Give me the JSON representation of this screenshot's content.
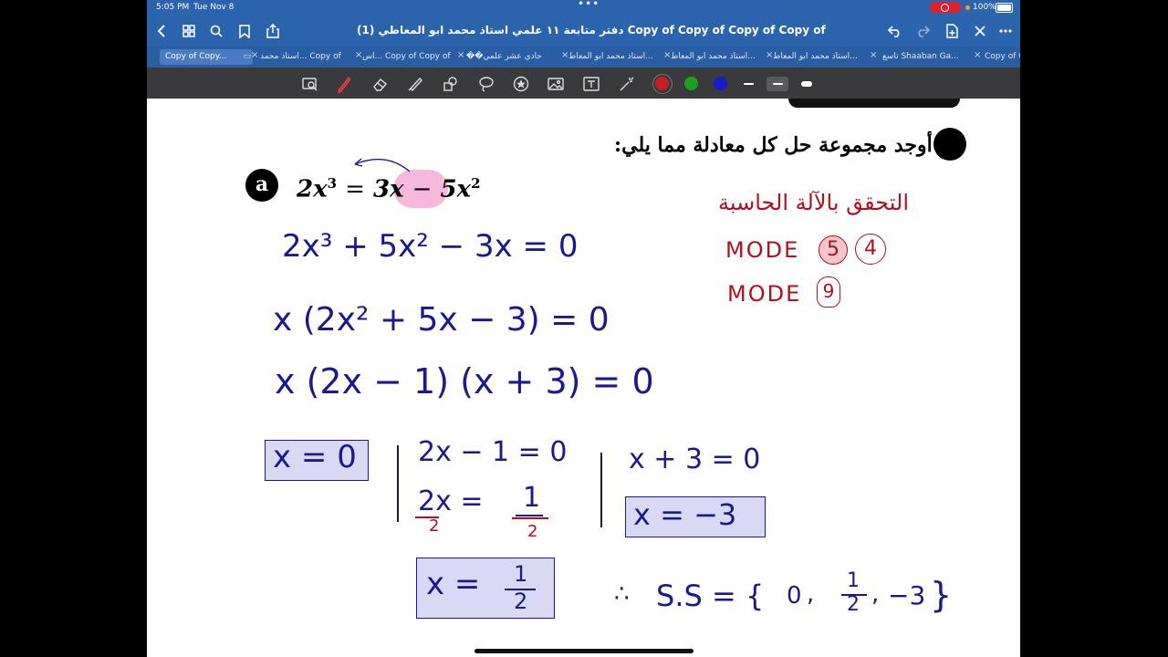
{
  "status_bar": {
    "time": "5:05 PM",
    "date": "Tue Nov 8",
    "battery": "100%"
  },
  "title_bar": {
    "title": "دفتر متابعة ١١ علمي استاذ محمد ابو المعاطي (1) Copy of Copy of Copy of Copy of"
  },
  "tabs": [
    {
      "label": "Copy of Copy..."
    },
    {
      "label": "استاذ محمد... Copy of"
    },
    {
      "label": "اس... Copy of Copy of"
    },
    {
      "label": "��حادي عشر علمي"
    },
    {
      "label": "استاذ محمد ابو المعاط..."
    },
    {
      "label": "استاذ محمد ابو المعاط..."
    },
    {
      "label": "استاذ محمد ابو المعاط..."
    },
    {
      "label": "تاسع Shaaban Ga..."
    },
    {
      "label": "Copy of C"
    }
  ],
  "toolbar": {
    "tools": [
      "lasso-icon",
      "pen-icon",
      "eraser-icon",
      "highlighter-icon",
      "shapes-icon",
      "lasso-select-icon",
      "sticker-icon",
      "image-icon",
      "text-icon",
      "laser-icon"
    ],
    "colors": [
      "#c81e1e",
      "#1e9e1e",
      "#1a1acc"
    ]
  },
  "page": {
    "instruction": "أوجد مجموعة حل كل معادلة مما يلي:",
    "label": "a",
    "equation": {
      "lhs": "2x",
      "lhs_exp": "3",
      "eq": "=",
      "term": "3x",
      "minus": "−",
      "term2": "5x",
      "term2_exp": "2"
    },
    "steps": [
      "2x³ + 5x² − 3x = 0",
      "x (2x² + 5x − 3) = 0",
      "x (2x − 1) (x + 3) = 0"
    ],
    "cases": {
      "case1_box": "x = 0",
      "case2_line1": "2x − 1 = 0",
      "case2_line2_lhs": "2x =",
      "case2_line2_rhs_num": "1",
      "case2_div_left": "2",
      "case2_div_right": "2",
      "case2_box_lhs": "x =",
      "case2_box_num": "1",
      "case2_box_den": "2",
      "case3_line1": "x + 3 = 0",
      "case3_box": "x = −3"
    },
    "solution": {
      "therefore": "∴",
      "label": "S.S = {",
      "v0": "0",
      "sep1": ",",
      "num": "1",
      "den": "2",
      "sep2": ",",
      "v3": "−3",
      "close": "}"
    },
    "calc_note": {
      "title": "التحقق بالآلة الحاسبة",
      "mode1": "MODE",
      "mode1_keys": [
        "5",
        "4"
      ],
      "mode2": "MODE",
      "mode2_key": "9"
    }
  }
}
